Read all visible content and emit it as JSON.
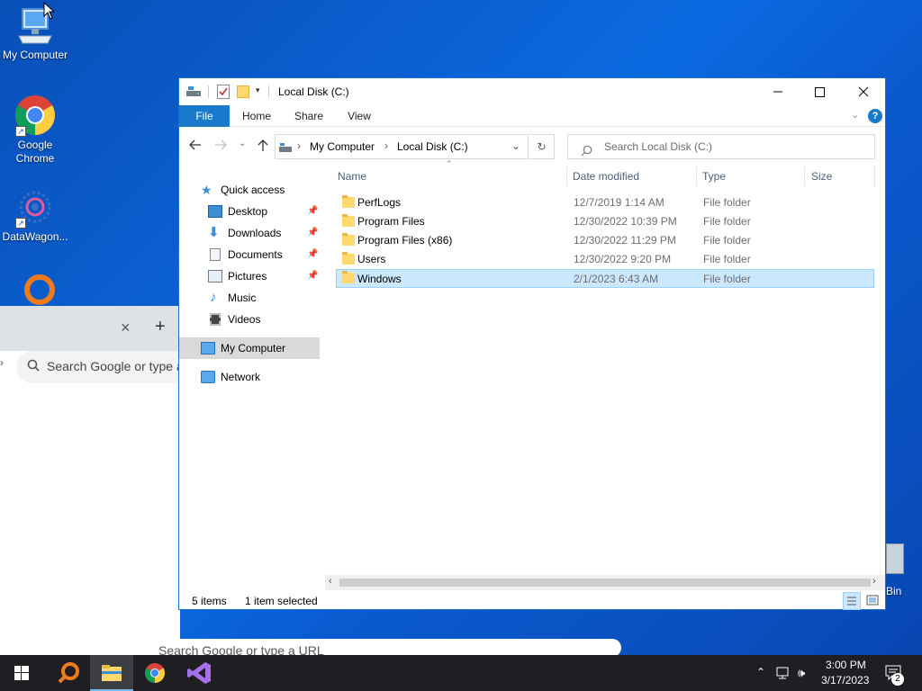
{
  "desktop": {
    "icons": [
      {
        "label": "My Computer"
      },
      {
        "label": "Google Chrome"
      },
      {
        "label": "DataWagon..."
      },
      {
        "label": "Bin"
      }
    ]
  },
  "background_browser": {
    "tab_close": "×",
    "tab_new": "+",
    "search_placeholder": "Search Google or type a",
    "ntp_search_placeholder": "Search Google or type a URL"
  },
  "explorer": {
    "title": "Local Disk (C:)",
    "window_controls": {
      "minimize": "—",
      "maximize": "☐",
      "close": "✕"
    },
    "ribbon_tabs": [
      {
        "label": "File"
      },
      {
        "label": "Home"
      },
      {
        "label": "Share"
      },
      {
        "label": "View"
      }
    ],
    "breadcrumb": [
      "My Computer",
      "Local Disk (C:)"
    ],
    "breadcrumb_sep": "›",
    "search_placeholder": "Search Local Disk (C:)",
    "nav_tree": [
      {
        "label": "Quick access",
        "icon": "star-icon"
      },
      {
        "label": "Desktop",
        "icon": "desktop-icon",
        "pinned": true
      },
      {
        "label": "Downloads",
        "icon": "downloads-icon",
        "pinned": true
      },
      {
        "label": "Documents",
        "icon": "documents-icon",
        "pinned": true
      },
      {
        "label": "Pictures",
        "icon": "pictures-icon",
        "pinned": true
      },
      {
        "label": "Music",
        "icon": "music-icon"
      },
      {
        "label": "Videos",
        "icon": "videos-icon"
      },
      {
        "label": "My Computer",
        "icon": "computer-icon",
        "selected": true
      },
      {
        "label": "Network",
        "icon": "network-icon"
      }
    ],
    "columns": [
      {
        "label": "Name"
      },
      {
        "label": "Date modified"
      },
      {
        "label": "Type"
      },
      {
        "label": "Size"
      }
    ],
    "rows": [
      {
        "name": "PerfLogs",
        "date": "12/7/2019 1:14 AM",
        "type": "File folder",
        "selected": false
      },
      {
        "name": "Program Files",
        "date": "12/30/2022 10:39 PM",
        "type": "File folder",
        "selected": false
      },
      {
        "name": "Program Files (x86)",
        "date": "12/30/2022 11:29 PM",
        "type": "File folder",
        "selected": false
      },
      {
        "name": "Users",
        "date": "12/30/2022 9:20 PM",
        "type": "File folder",
        "selected": false
      },
      {
        "name": "Windows",
        "date": "2/1/2023 6:43 AM",
        "type": "File folder",
        "selected": true
      }
    ],
    "status": {
      "items": "5 items",
      "selected": "1 item selected"
    }
  },
  "taskbar": {
    "clock_time": "3:00 PM",
    "clock_date": "3/17/2023",
    "notification_count": "2"
  },
  "colors": {
    "accent": "#1979ca",
    "selection": "#cce8ff",
    "taskbar": "#1e1e23"
  }
}
